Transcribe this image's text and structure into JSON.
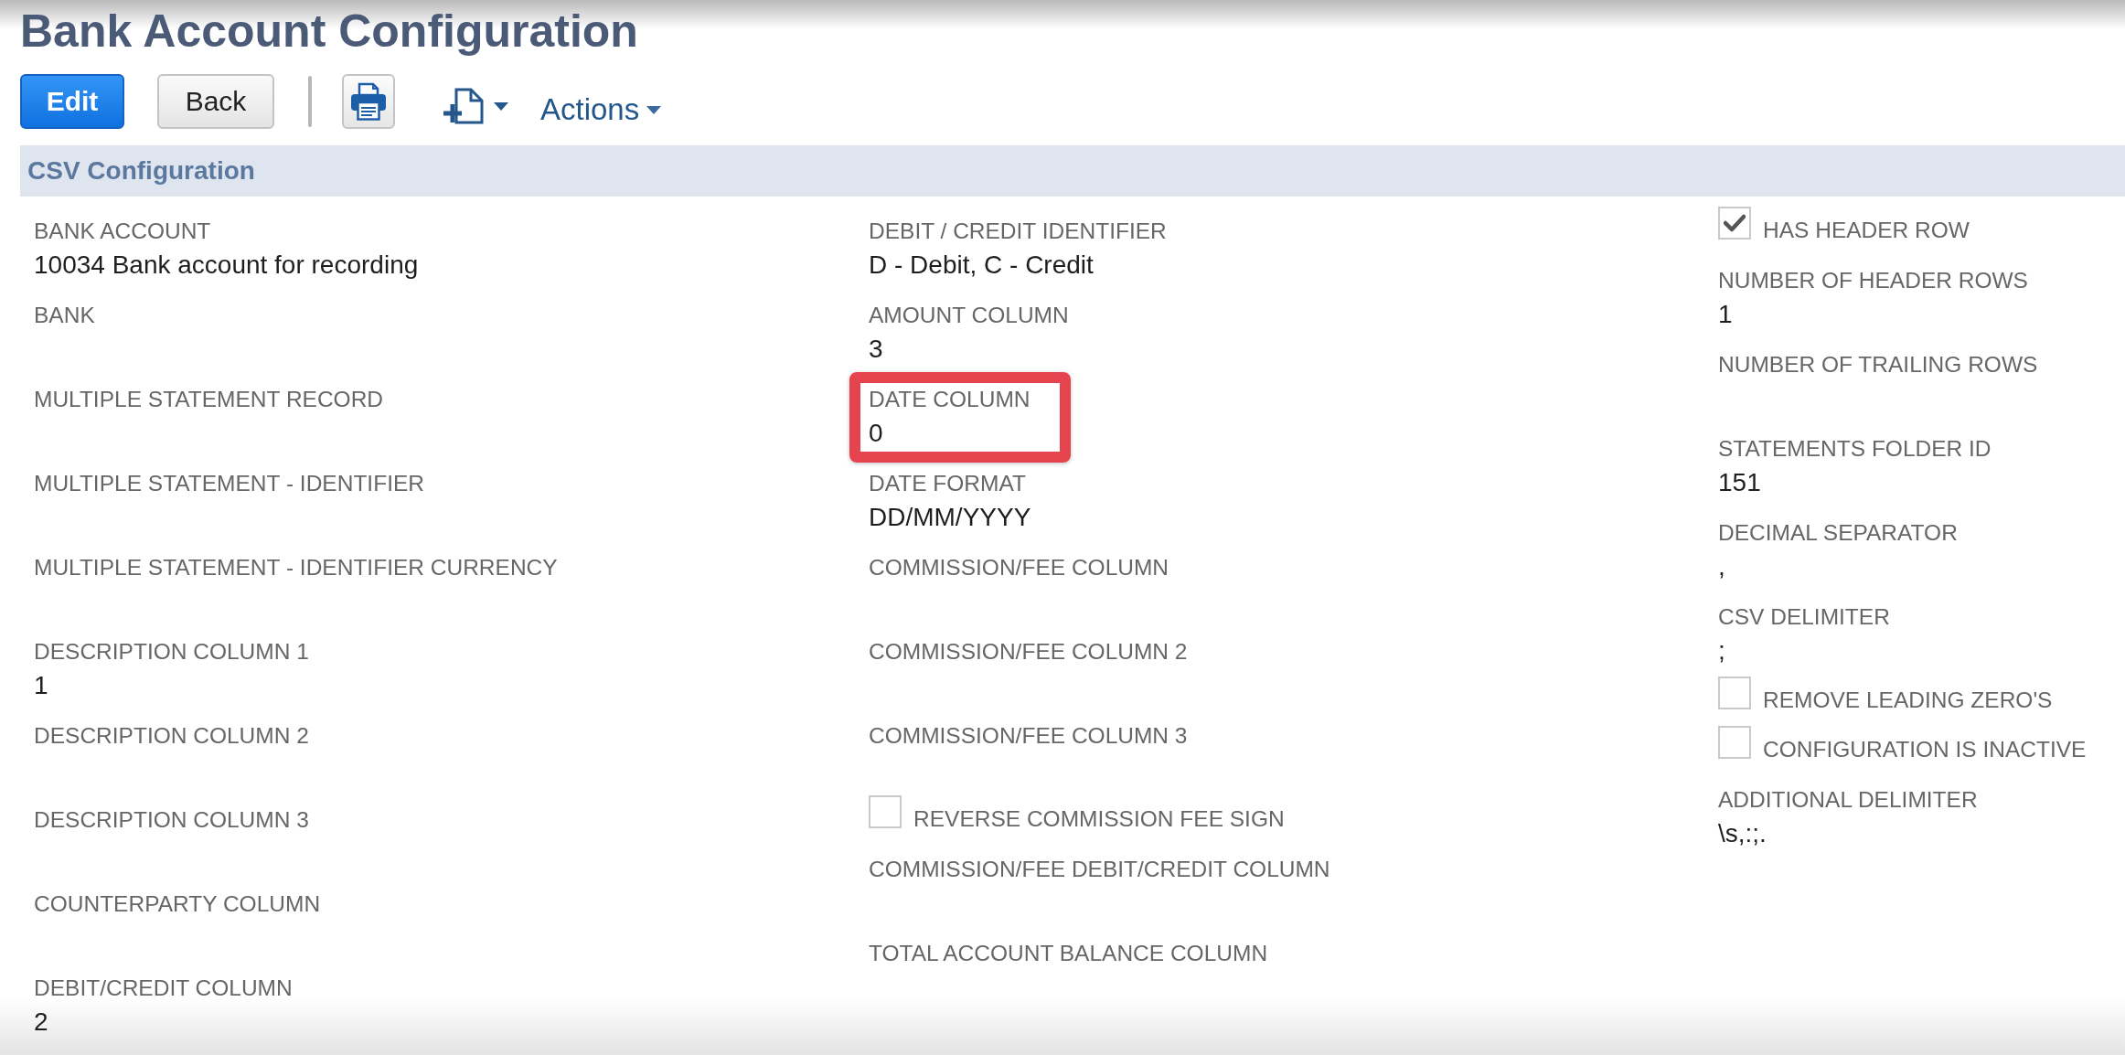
{
  "page": {
    "title": "Bank Account Configuration"
  },
  "toolbar": {
    "buttons": [
      {
        "label": "Edit",
        "kind": "primary"
      },
      {
        "label": "Back",
        "kind": "secondary"
      }
    ],
    "actions_menu": {
      "label": "Actions"
    }
  },
  "section": {
    "title": "CSV Configuration",
    "columns": [
      {
        "fields": [
          {
            "kind": "field",
            "label": "BANK ACCOUNT",
            "value": "10034 Bank account for recording",
            "highlighted": false
          },
          {
            "kind": "field",
            "label": "BANK",
            "highlighted": false
          },
          {
            "kind": "field",
            "label": "MULTIPLE STATEMENT RECORD",
            "highlighted": false
          },
          {
            "kind": "field",
            "label": "MULTIPLE STATEMENT - IDENTIFIER",
            "highlighted": false
          },
          {
            "kind": "field",
            "label": "MULTIPLE STATEMENT - IDENTIFIER CURRENCY",
            "highlighted": false
          },
          {
            "kind": "field",
            "label": "DESCRIPTION COLUMN 1",
            "value": "1",
            "highlighted": false
          },
          {
            "kind": "field",
            "label": "DESCRIPTION COLUMN 2",
            "highlighted": false
          },
          {
            "kind": "field",
            "label": "DESCRIPTION COLUMN 3",
            "highlighted": false
          },
          {
            "kind": "field",
            "label": "COUNTERPARTY COLUMN",
            "highlighted": false
          },
          {
            "kind": "field",
            "label": "DEBIT/CREDIT COLUMN",
            "value": "2",
            "highlighted": false
          }
        ]
      },
      {
        "fields": [
          {
            "kind": "field",
            "label": "DEBIT / CREDIT IDENTIFIER",
            "value": "D - Debit, C - Credit",
            "highlighted": false
          },
          {
            "kind": "field",
            "label": "AMOUNT COLUMN",
            "value": "3",
            "highlighted": false
          },
          {
            "kind": "field",
            "label": "DATE COLUMN",
            "value": "0",
            "highlighted": true
          },
          {
            "kind": "field",
            "label": "DATE FORMAT",
            "value": "DD/MM/YYYY",
            "highlighted": false
          },
          {
            "kind": "field",
            "label": "COMMISSION/FEE COLUMN",
            "highlighted": false
          },
          {
            "kind": "field",
            "label": "COMMISSION/FEE COLUMN 2",
            "highlighted": false
          },
          {
            "kind": "field",
            "label": "COMMISSION/FEE COLUMN 3",
            "highlighted": false
          },
          {
            "kind": "checkbox",
            "label": "REVERSE COMMISSION FEE SIGN",
            "checked": false,
            "highlighted": false
          },
          {
            "kind": "field",
            "label": "COMMISSION/FEE DEBIT/CREDIT COLUMN",
            "highlighted": false
          },
          {
            "kind": "field",
            "label": "TOTAL ACCOUNT BALANCE COLUMN",
            "highlighted": false
          }
        ]
      },
      {
        "fields": [
          {
            "kind": "checkbox",
            "label": "HAS HEADER ROW",
            "checked": true,
            "highlighted": false
          },
          {
            "kind": "field",
            "label": "NUMBER OF HEADER ROWS",
            "value": "1",
            "highlighted": false
          },
          {
            "kind": "field",
            "label": "NUMBER OF TRAILING ROWS",
            "highlighted": false
          },
          {
            "kind": "field",
            "label": "STATEMENTS FOLDER ID",
            "value": "151",
            "highlighted": false
          },
          {
            "kind": "field",
            "label": "DECIMAL SEPARATOR",
            "value": ",",
            "highlighted": false
          },
          {
            "kind": "field",
            "label": "CSV DELIMITER",
            "value": ";",
            "highlighted": false
          },
          {
            "kind": "checkbox",
            "label": "REMOVE LEADING ZERO'S",
            "checked": false,
            "highlighted": false
          },
          {
            "kind": "checkbox",
            "label": "CONFIGURATION IS INACTIVE",
            "checked": false,
            "highlighted": false
          },
          {
            "kind": "field",
            "label": "ADDITIONAL DELIMITER",
            "value": "\\s,:;.",
            "highlighted": false
          }
        ]
      }
    ]
  }
}
